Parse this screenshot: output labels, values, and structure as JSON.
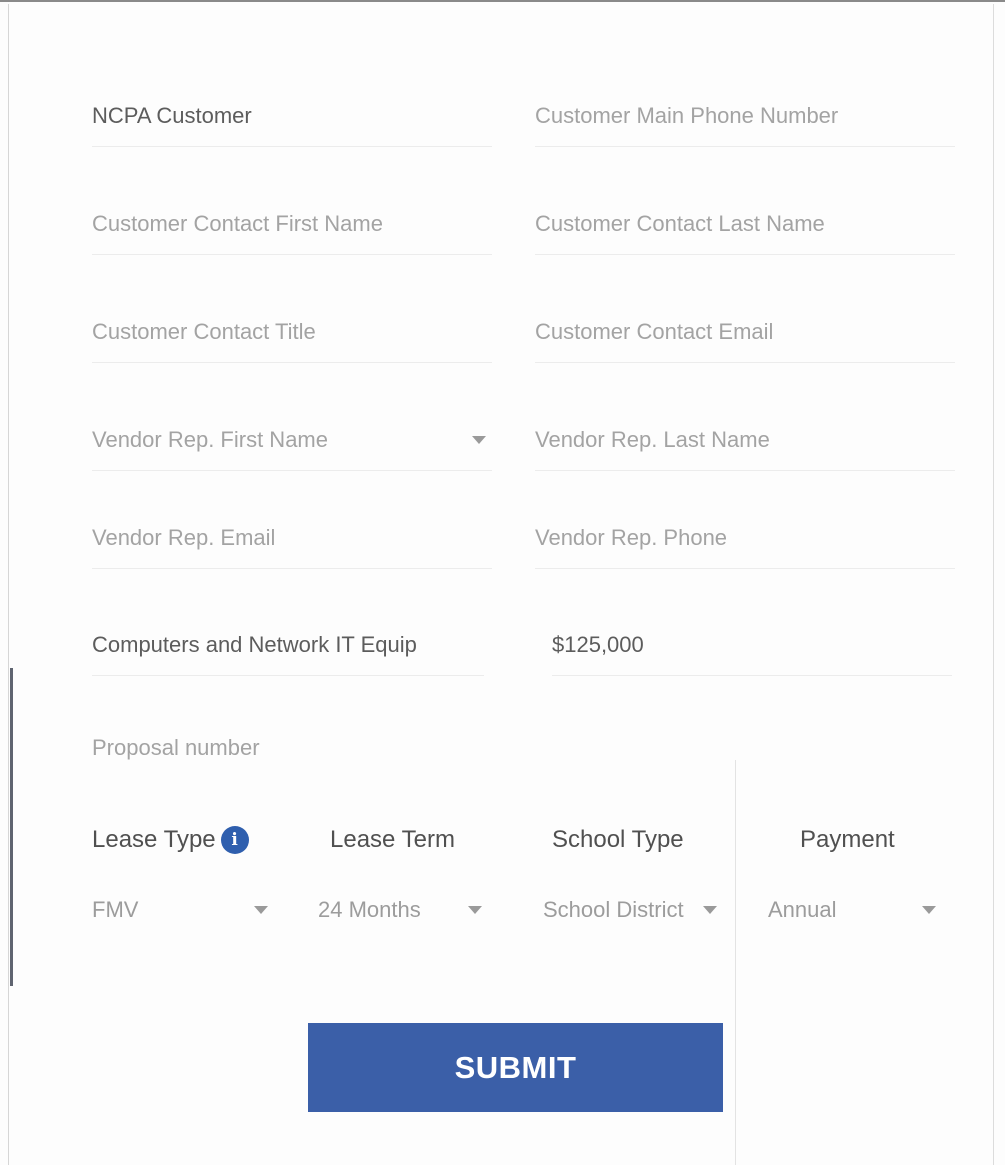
{
  "form": {
    "fields": {
      "ncpa_customer": "NCPA Customer",
      "customer_main_phone": "Customer Main Phone Number",
      "contact_first_name": "Customer  Contact First Name",
      "contact_last_name": "Customer Contact Last Name",
      "contact_title": "Customer Contact Title",
      "contact_email": "Customer Contact Email",
      "vendor_first_name": "Vendor Rep. First Name",
      "vendor_last_name": "Vendor Rep. Last Name",
      "vendor_email": "Vendor Rep. Email",
      "vendor_phone": "Vendor Rep. Phone",
      "equipment_type": "Computers and Network IT Equip",
      "amount": "$125,000",
      "proposal_number": "Proposal number"
    },
    "lease": {
      "lease_type_label": "Lease Type",
      "lease_type_value": "FMV",
      "lease_term_label": "Lease Term",
      "lease_term_value": "24 Months",
      "school_type_label": "School Type",
      "school_type_value": "School District",
      "payment_label": "Payment",
      "payment_value": "Annual"
    },
    "info_icon_glyph": "i",
    "submit_label": "SUBMIT"
  },
  "colors": {
    "submit_bg": "#3b5fa8",
    "info_icon_bg": "#2f5fae",
    "placeholder_text": "#a3a3a3",
    "filled_text": "#5c5c5c"
  },
  "icons": {
    "info": "info-icon",
    "dropdown": "caret-down-icon"
  }
}
